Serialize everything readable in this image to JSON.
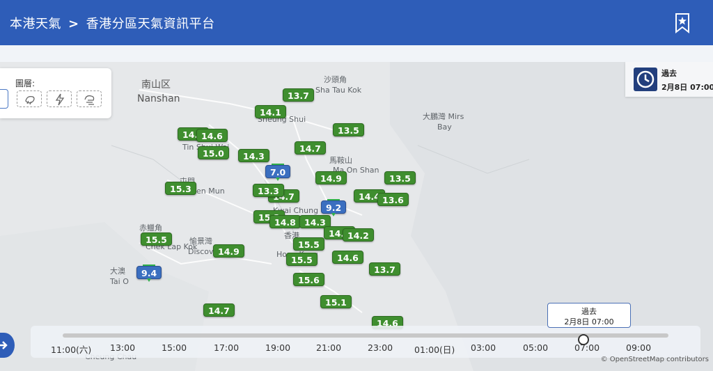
{
  "header": {
    "home": "本港天氣",
    "separator": ">",
    "page": "香港分區天氣資訊平台"
  },
  "layers": {
    "title": "圖層:"
  },
  "time_box": {
    "label": "過去",
    "datetime": "2月8日 07:00"
  },
  "places": [
    {
      "text": "南山区",
      "big": true
    },
    {
      "text": "Nanshan",
      "big": true
    },
    {
      "text": "沙頭角"
    },
    {
      "text": "Sha Tau Kok"
    },
    {
      "text": "大鵬灣 Mirs"
    },
    {
      "text": "Bay"
    },
    {
      "text": "Sheung Shui"
    },
    {
      "text": "Tin Shui Wai"
    },
    {
      "text": "馬鞍山"
    },
    {
      "text": "Ma On Shan"
    },
    {
      "text": "屯門"
    },
    {
      "text": "Tuen Mun"
    },
    {
      "text": "Kwai Chung"
    },
    {
      "text": "赤鱲角"
    },
    {
      "text": "Chek Lap Kok"
    },
    {
      "text": "愉景灣"
    },
    {
      "text": "Discovery Bay"
    },
    {
      "text": "香港"
    },
    {
      "text": "Hong Kong"
    },
    {
      "text": "大澳"
    },
    {
      "text": "Tai O"
    },
    {
      "text": "Cheung Chau"
    }
  ],
  "stations": [
    {
      "v": "13.7",
      "c": "green"
    },
    {
      "v": "14.1",
      "c": "green"
    },
    {
      "v": "13.5",
      "c": "green"
    },
    {
      "v": "14.5",
      "c": "green"
    },
    {
      "v": "14.6",
      "c": "green"
    },
    {
      "v": "15.0",
      "c": "green"
    },
    {
      "v": "14.3",
      "c": "green"
    },
    {
      "v": "14.7",
      "c": "green"
    },
    {
      "v": "7.0",
      "c": "blue"
    },
    {
      "v": "14.9",
      "c": "green"
    },
    {
      "v": "13.5",
      "c": "green"
    },
    {
      "v": "15.3",
      "c": "green"
    },
    {
      "v": "14.7",
      "c": "green"
    },
    {
      "v": "13.3",
      "c": "green"
    },
    {
      "v": "14.4",
      "c": "green"
    },
    {
      "v": "13.6",
      "c": "green"
    },
    {
      "v": "9.2",
      "c": "blue"
    },
    {
      "v": "15.2",
      "c": "green"
    },
    {
      "v": "14.8",
      "c": "green"
    },
    {
      "v": "14.3",
      "c": "green"
    },
    {
      "v": "14.1",
      "c": "green"
    },
    {
      "v": "14.2",
      "c": "green"
    },
    {
      "v": "15.5",
      "c": "green"
    },
    {
      "v": "15.5",
      "c": "green"
    },
    {
      "v": "14.9",
      "c": "green"
    },
    {
      "v": "15.5",
      "c": "green"
    },
    {
      "v": "14.6",
      "c": "green"
    },
    {
      "v": "13.7",
      "c": "green"
    },
    {
      "v": "9.4",
      "c": "blue"
    },
    {
      "v": "15.6",
      "c": "green"
    },
    {
      "v": "15.1",
      "c": "green"
    },
    {
      "v": "14.7",
      "c": "green"
    },
    {
      "v": "14.6",
      "c": "green"
    }
  ],
  "timeline": {
    "ticks": [
      "11:00(六)",
      "13:00",
      "15:00",
      "17:00",
      "19:00",
      "21:00",
      "23:00",
      "01:00(日)",
      "03:00",
      "05:00",
      "07:00",
      "09:00"
    ],
    "position": 0.86,
    "bubble_label": "過去",
    "bubble_time": "2月8日 07:00"
  },
  "credit": "© OpenStreetMap contributors",
  "colors": {
    "header": "#2e5db8",
    "station_green": "#3f8e2f",
    "station_blue": "#3b6fc0"
  }
}
